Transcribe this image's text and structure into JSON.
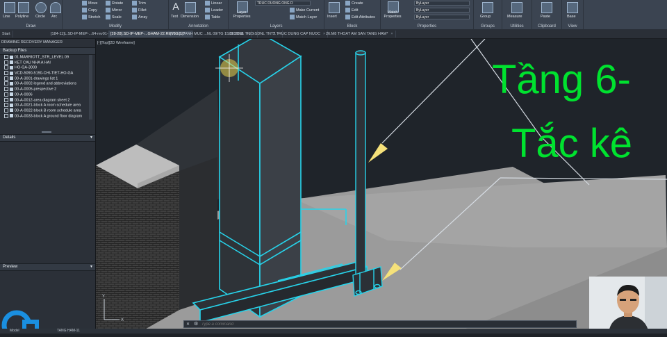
{
  "ribbon": {
    "groups": [
      {
        "label": "Draw",
        "buttons": [
          "Line",
          "Polyline",
          "Circle",
          "Arc"
        ]
      },
      {
        "label": "Modify",
        "buttons": [
          "Move",
          "Rotate",
          "Trim",
          "Copy",
          "Mirror",
          "Fillet",
          "Stretch",
          "Scale",
          "Array"
        ]
      },
      {
        "label": "Annotation",
        "buttons": [
          "Text",
          "Dimension",
          "Linear",
          "Leader",
          "Table"
        ]
      },
      {
        "label": "Layers",
        "buttons": [
          "Layer Properties",
          "Make Current",
          "Match Layer"
        ],
        "layer_value": "TRUC DUONG ONG D"
      },
      {
        "label": "Block",
        "buttons": [
          "Insert",
          "Create",
          "Edit",
          "Edit Attributes"
        ]
      },
      {
        "label": "Properties",
        "buttons": [
          "Match Properties"
        ],
        "dropdowns": [
          "ByLayer",
          "ByLayer",
          "ByLayer"
        ]
      },
      {
        "label": "Groups",
        "buttons": [
          "Group"
        ]
      },
      {
        "label": "Utilities",
        "buttons": [
          "Measure"
        ]
      },
      {
        "label": "Clipboard",
        "buttons": [
          "Paste"
        ]
      },
      {
        "label": "View",
        "buttons": [
          "Base"
        ]
      }
    ]
  },
  "tabs": {
    "items": [
      {
        "label": "Start",
        "active": false
      },
      {
        "label": "[184-11]L.SD-IP-MEP-...64-rev01-10122018*",
        "active": false
      },
      {
        "label": "[28-28].SD-IP-MEP-...GHAM-22.REV03 (1)*",
        "active": true
      },
      {
        "label": "[01-18.DANH MUC ...NL 09/TG 15.08.2018",
        "active": false
      },
      {
        "label": "23.SDNL TN",
        "active": false
      },
      {
        "label": "23.SDNL TNT*",
        "active": false
      },
      {
        "label": "3.TRUC DUNG CAP NUOC",
        "active": false
      },
      {
        "label": "26.M8 THOAT AM SAN TANG HAM*",
        "active": false
      }
    ]
  },
  "palette": {
    "title": "DRAWING RECOVERY MANAGER",
    "backup_header": "Backup Files",
    "files": [
      "01.MARRIOTT_STR_LEVEL 09",
      "KET CAU NHA A HAI",
      "HO-GA-3000",
      "VCD-5090-5190-CHI-TIET-HO-GA",
      "00-A-3001-drawings list 1",
      "00-A-0002-legend and abbreviations",
      "00-A-0005-prespective 2",
      "00-A-0006",
      "00-A-0012-area diagram sheet 2",
      "00-A-0021-block A room schedule area",
      "00-A-0022-block B room schedule area",
      "00-A-0033-block A ground floor diagram"
    ],
    "details_header": "Details",
    "preview_header": "Preview"
  },
  "viewport": {
    "label": "[-][Top][2D Wireframe]"
  },
  "overlay": {
    "line1": "Tầng 6-",
    "line2": "Tắc kê"
  },
  "command": {
    "placeholder": "Type a command"
  },
  "status": {
    "model_tab": "Model",
    "layout_label": "TANG HAM-11"
  },
  "colors": {
    "ribbon_bg": "#3b4451",
    "viewport_bg": "#1f242a",
    "wireframe": "#27d3ea",
    "overlay_text": "#00e22f",
    "callout_arrow": "#f5e17a"
  }
}
